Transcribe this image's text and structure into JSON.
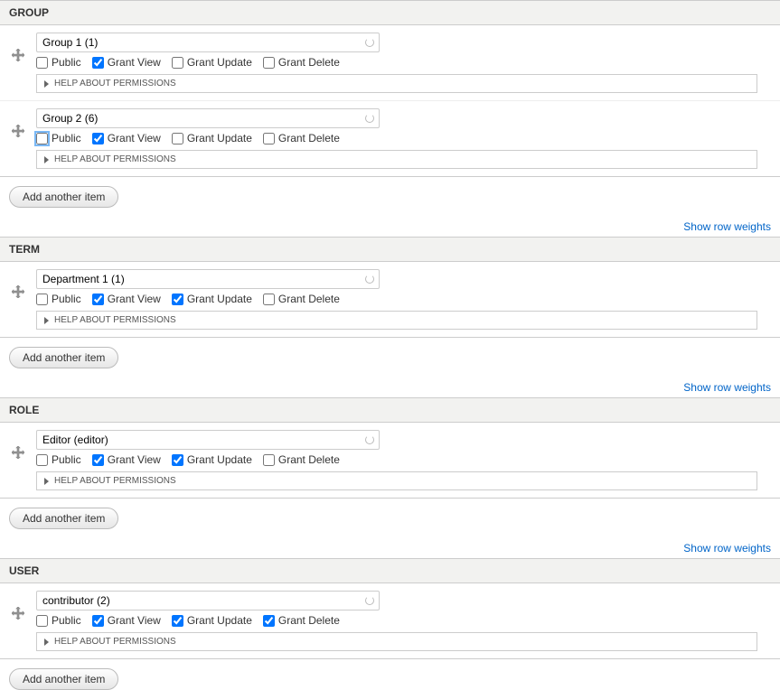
{
  "labels": {
    "public": "Public",
    "grant_view": "Grant View",
    "grant_update": "Grant Update",
    "grant_delete": "Grant Delete",
    "help_permissions": "Help about permissions",
    "add_another": "Add another item",
    "show_row_weights": "Show row weights"
  },
  "sections": [
    {
      "title": "Group",
      "items": [
        {
          "value": "Group 1 (1)",
          "public": false,
          "grant_view": true,
          "grant_update": false,
          "grant_delete": false,
          "highlight_public": false
        },
        {
          "value": "Group 2 (6)",
          "public": false,
          "grant_view": true,
          "grant_update": false,
          "grant_delete": false,
          "highlight_public": true
        }
      ]
    },
    {
      "title": "Term",
      "items": [
        {
          "value": "Department 1 (1)",
          "public": false,
          "grant_view": true,
          "grant_update": true,
          "grant_delete": false,
          "highlight_public": false
        }
      ]
    },
    {
      "title": "Role",
      "items": [
        {
          "value": "Editor (editor)",
          "public": false,
          "grant_view": true,
          "grant_update": true,
          "grant_delete": false,
          "highlight_public": false
        }
      ]
    },
    {
      "title": "User",
      "items": [
        {
          "value": "contributor (2)",
          "public": false,
          "grant_view": true,
          "grant_update": true,
          "grant_delete": true,
          "highlight_public": false
        }
      ]
    }
  ]
}
